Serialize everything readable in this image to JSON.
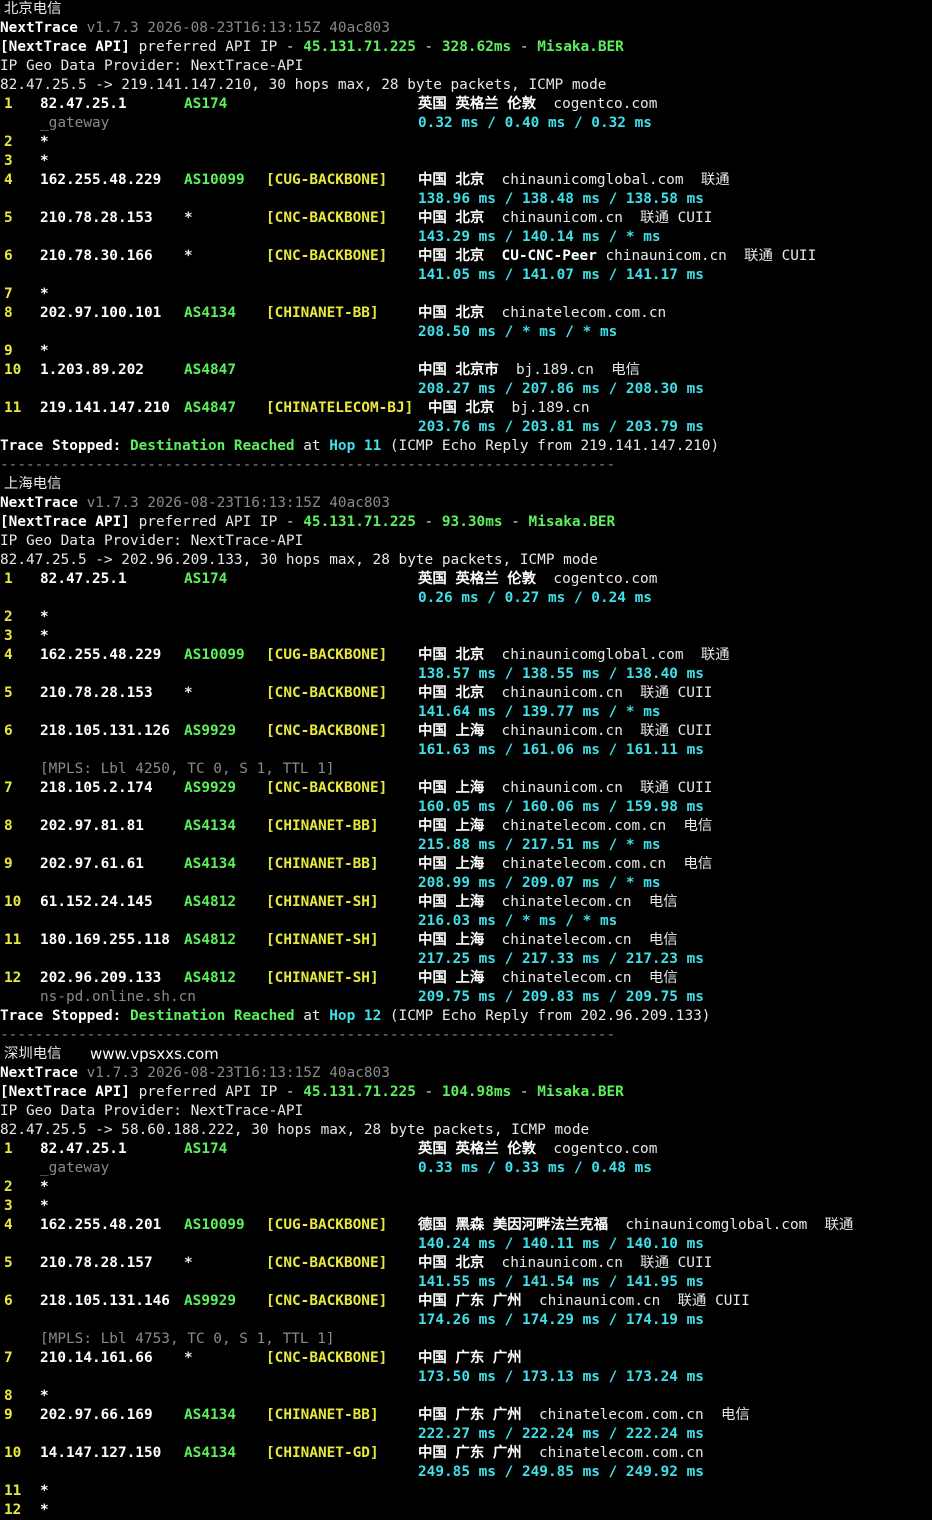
{
  "sections": [
    {
      "label": "北京电信",
      "watermark": "",
      "header": {
        "tool": "NextTrace",
        "version": "v1.7.3 2026-08-23T16:13:15Z 40ac803",
        "api_prefix": "[NextTrace API]",
        "api_mid": " preferred API IP - ",
        "api_ip": "45.131.71.225",
        "api_dash": " - ",
        "api_ms": "328.62ms",
        "api_node": "Misaka.BER",
        "geo_provider": "IP Geo Data Provider: NextTrace-API",
        "route": "82.47.25.5 -> 219.141.147.210, 30 hops max, 28 byte packets, ICMP mode"
      },
      "hops": [
        {
          "hop": "1",
          "ip": "82.47.25.1",
          "asn": "AS174",
          "tag": "",
          "geo": "英国 英格兰 伦敦",
          "extra": "cogentco.com",
          "rtt": "0.32 ms / 0.40 ms / 0.32 ms",
          "host": "_gateway",
          "mpls": ""
        },
        {
          "hop": "2",
          "ip": "*",
          "asn": "",
          "tag": "",
          "geo": "",
          "extra": "",
          "rtt": "",
          "host": "",
          "mpls": ""
        },
        {
          "hop": "3",
          "ip": "*",
          "asn": "",
          "tag": "",
          "geo": "",
          "extra": "",
          "rtt": "",
          "host": "",
          "mpls": ""
        },
        {
          "hop": "4",
          "ip": "162.255.48.229",
          "asn": "AS10099",
          "tag": "[CUG-BACKBONE]",
          "geo": "中国 北京",
          "extra": "  chinaunicomglobal.com  联通",
          "rtt": "138.96 ms / 138.48 ms / 138.58 ms",
          "host": "",
          "mpls": ""
        },
        {
          "hop": "5",
          "ip": "210.78.28.153",
          "asn": "*",
          "tag": "[CNC-BACKBONE]",
          "geo": "中国 北京",
          "extra": "  chinaunicom.cn  联通 CUII",
          "rtt": "143.29 ms / 140.14 ms / * ms",
          "host": "",
          "mpls": ""
        },
        {
          "hop": "6",
          "ip": "210.78.30.166",
          "asn": "*",
          "tag": "[CNC-BACKBONE]",
          "geo": "中国 北京  CU-CNC-Peer",
          "extra": " chinaunicom.cn  联通 CUII",
          "rtt": "141.05 ms / 141.07 ms / 141.17 ms",
          "host": "",
          "mpls": ""
        },
        {
          "hop": "7",
          "ip": "*",
          "asn": "",
          "tag": "",
          "geo": "",
          "extra": "",
          "rtt": "",
          "host": "",
          "mpls": ""
        },
        {
          "hop": "8",
          "ip": "202.97.100.101",
          "asn": "AS4134",
          "tag": "[CHINANET-BB]",
          "geo": "中国 北京",
          "extra": "  chinatelecom.com.cn",
          "rtt": "208.50 ms / * ms / * ms",
          "host": "",
          "mpls": ""
        },
        {
          "hop": "9",
          "ip": "*",
          "asn": "",
          "tag": "",
          "geo": "",
          "extra": "",
          "rtt": "",
          "host": "",
          "mpls": ""
        },
        {
          "hop": "10",
          "ip": "1.203.89.202",
          "asn": "AS4847",
          "tag": "",
          "geo": "中国 北京市",
          "extra": "  bj.189.cn  电信",
          "rtt": "208.27 ms / 207.86 ms / 208.30 ms",
          "host": "",
          "mpls": ""
        },
        {
          "hop": "11",
          "ip": "219.141.147.210",
          "asn": "AS4847",
          "tag": "[CHINATELECOM-BJ]",
          "geo": "中国 北京",
          "extra": "  bj.189.cn",
          "rtt": "203.76 ms / 203.81 ms / 203.79 ms",
          "host": "",
          "mpls": ""
        }
      ],
      "stop": {
        "label": "Trace Stopped:",
        "dest": "Destination Reached",
        "at": " at ",
        "hop": "Hop 11",
        "tail": " (ICMP Echo Reply from 219.141.147.210)"
      },
      "separator": "-----------------------------------------------------------------------"
    },
    {
      "label": "上海电信",
      "watermark": "",
      "header": {
        "tool": "NextTrace",
        "version": "v1.7.3 2026-08-23T16:13:15Z 40ac803",
        "api_prefix": "[NextTrace API]",
        "api_mid": " preferred API IP - ",
        "api_ip": "45.131.71.225",
        "api_dash": " - ",
        "api_ms": "93.30ms",
        "api_node": "Misaka.BER",
        "geo_provider": "IP Geo Data Provider: NextTrace-API",
        "route": "82.47.25.5 -> 202.96.209.133, 30 hops max, 28 byte packets, ICMP mode"
      },
      "hops": [
        {
          "hop": "1",
          "ip": "82.47.25.1",
          "asn": "AS174",
          "tag": "",
          "geo": "英国 英格兰 伦敦",
          "extra": "cogentco.com",
          "rtt": "0.26 ms / 0.27 ms / 0.24 ms",
          "host": " ",
          "mpls": ""
        },
        {
          "hop": "2",
          "ip": "*",
          "asn": "",
          "tag": "",
          "geo": "",
          "extra": "",
          "rtt": "",
          "host": "",
          "mpls": ""
        },
        {
          "hop": "3",
          "ip": "*",
          "asn": "",
          "tag": "",
          "geo": "",
          "extra": "",
          "rtt": "",
          "host": "",
          "mpls": ""
        },
        {
          "hop": "4",
          "ip": "162.255.48.229",
          "asn": "AS10099",
          "tag": "[CUG-BACKBONE]",
          "geo": "中国 北京",
          "extra": "  chinaunicomglobal.com  联通",
          "rtt": "138.57 ms / 138.55 ms / 138.40 ms",
          "host": "",
          "mpls": ""
        },
        {
          "hop": "5",
          "ip": "210.78.28.153",
          "asn": "*",
          "tag": "[CNC-BACKBONE]",
          "geo": "中国 北京",
          "extra": "  chinaunicom.cn  联通 CUII",
          "rtt": "141.64 ms / 139.77 ms / * ms",
          "host": "",
          "mpls": ""
        },
        {
          "hop": "6",
          "ip": "218.105.131.126",
          "asn": "AS9929",
          "tag": "[CNC-BACKBONE]",
          "geo": "中国 上海",
          "extra": "  chinaunicom.cn  联通 CUII",
          "rtt": "161.63 ms / 161.06 ms / 161.11 ms",
          "host": " ",
          "mpls": "[MPLS: Lbl 4250, TC 0, S 1, TTL 1]"
        },
        {
          "hop": "7",
          "ip": "218.105.2.174",
          "asn": "AS9929",
          "tag": "[CNC-BACKBONE]",
          "geo": "中国 上海",
          "extra": "  chinaunicom.cn  联通 CUII",
          "rtt": "160.05 ms / 160.06 ms / 159.98 ms",
          "host": "",
          "mpls": ""
        },
        {
          "hop": "8",
          "ip": "202.97.81.81",
          "asn": "AS4134",
          "tag": "[CHINANET-BB]",
          "geo": "中国 上海",
          "extra": "  chinatelecom.com.cn  电信",
          "rtt": "215.88 ms / 217.51 ms / * ms",
          "host": "",
          "mpls": ""
        },
        {
          "hop": "9",
          "ip": "202.97.61.61",
          "asn": "AS4134",
          "tag": "[CHINANET-BB]",
          "geo": "中国 上海",
          "extra": "  chinatelecom.com.cn  电信",
          "rtt": "208.99 ms / 209.07 ms / * ms",
          "host": "",
          "mpls": ""
        },
        {
          "hop": "10",
          "ip": "61.152.24.145",
          "asn": "AS4812",
          "tag": "[CHINANET-SH]",
          "geo": "中国 上海",
          "extra": "  chinatelecom.cn  电信",
          "rtt": "216.03 ms / * ms / * ms",
          "host": "",
          "mpls": ""
        },
        {
          "hop": "11",
          "ip": "180.169.255.118",
          "asn": "AS4812",
          "tag": "[CHINANET-SH]",
          "geo": "中国 上海",
          "extra": "  chinatelecom.cn  电信",
          "rtt": "217.25 ms / 217.33 ms / 217.23 ms",
          "host": "",
          "mpls": ""
        },
        {
          "hop": "12",
          "ip": "202.96.209.133",
          "asn": "AS4812",
          "tag": "[CHINANET-SH]",
          "geo": "中国 上海",
          "extra": "  chinatelecom.cn  电信",
          "rtt": "209.75 ms / 209.83 ms / 209.75 ms",
          "host": "ns-pd.online.sh.cn",
          "mpls": ""
        }
      ],
      "stop": {
        "label": "Trace Stopped:",
        "dest": "Destination Reached",
        "at": " at ",
        "hop": "Hop 12",
        "tail": " (ICMP Echo Reply from 202.96.209.133)"
      },
      "separator": "-----------------------------------------------------------------------"
    },
    {
      "label": "深圳电信",
      "watermark": "www.vpsxxs.com",
      "header": {
        "tool": "NextTrace",
        "version": "v1.7.3 2026-08-23T16:13:15Z 40ac803",
        "api_prefix": "[NextTrace API]",
        "api_mid": " preferred API IP - ",
        "api_ip": "45.131.71.225",
        "api_dash": " - ",
        "api_ms": "104.98ms",
        "api_node": "Misaka.BER",
        "geo_provider": "IP Geo Data Provider: NextTrace-API",
        "route": "82.47.25.5 -> 58.60.188.222, 30 hops max, 28 byte packets, ICMP mode"
      },
      "hops": [
        {
          "hop": "1",
          "ip": "82.47.25.1",
          "asn": "AS174",
          "tag": "",
          "geo": "英国 英格兰 伦敦",
          "extra": "cogentco.com",
          "rtt": "0.33 ms / 0.33 ms / 0.48 ms",
          "host": "_gateway",
          "mpls": ""
        },
        {
          "hop": "2",
          "ip": "*",
          "asn": "",
          "tag": "",
          "geo": "",
          "extra": "",
          "rtt": "",
          "host": "",
          "mpls": ""
        },
        {
          "hop": "3",
          "ip": "*",
          "asn": "",
          "tag": "",
          "geo": "",
          "extra": "",
          "rtt": "",
          "host": "",
          "mpls": ""
        },
        {
          "hop": "4",
          "ip": "162.255.48.201",
          "asn": "AS10099",
          "tag": "[CUG-BACKBONE]",
          "geo": "德国 黑森 美因河畔法兰克福",
          "extra": "  chinaunicomglobal.com  联通",
          "rtt": "140.24 ms / 140.11 ms / 140.10 ms",
          "host": "",
          "mpls": ""
        },
        {
          "hop": "5",
          "ip": "210.78.28.157",
          "asn": "*",
          "tag": "[CNC-BACKBONE]",
          "geo": "中国 北京",
          "extra": "  chinaunicom.cn  联通 CUII",
          "rtt": "141.55 ms / 141.54 ms / 141.95 ms",
          "host": "",
          "mpls": ""
        },
        {
          "hop": "6",
          "ip": "218.105.131.146",
          "asn": "AS9929",
          "tag": "[CNC-BACKBONE]",
          "geo": "中国 广东 广州",
          "extra": "  chinaunicom.cn  联通 CUII",
          "rtt": "174.26 ms / 174.29 ms / 174.19 ms",
          "host": " ",
          "mpls": "[MPLS: Lbl 4753, TC 0, S 1, TTL 1]"
        },
        {
          "hop": "7",
          "ip": "210.14.161.66",
          "asn": "*",
          "tag": "[CNC-BACKBONE]",
          "geo": "中国 广东 广州",
          "extra": "",
          "rtt": "173.50 ms / 173.13 ms / 173.24 ms",
          "host": " ",
          "mpls": ""
        },
        {
          "hop": "8",
          "ip": "*",
          "asn": "",
          "tag": "",
          "geo": "",
          "extra": "",
          "rtt": "",
          "host": "",
          "mpls": ""
        },
        {
          "hop": "9",
          "ip": "202.97.66.169",
          "asn": "AS4134",
          "tag": "[CHINANET-BB]",
          "geo": "中国 广东 广州",
          "extra": "  chinatelecom.com.cn  电信",
          "rtt": "222.27 ms / 222.24 ms / 222.24 ms",
          "host": "",
          "mpls": ""
        },
        {
          "hop": "10",
          "ip": "14.147.127.150",
          "asn": "AS4134",
          "tag": "[CHINANET-GD]",
          "geo": "中国 广东 广州",
          "extra": "  chinatelecom.com.cn",
          "rtt": "249.85 ms / 249.85 ms / 249.92 ms",
          "host": " ",
          "mpls": ""
        },
        {
          "hop": "11",
          "ip": "*",
          "asn": "",
          "tag": "",
          "geo": "",
          "extra": "",
          "rtt": "",
          "host": "",
          "mpls": ""
        },
        {
          "hop": "12",
          "ip": "*",
          "asn": "",
          "tag": "",
          "geo": "",
          "extra": "",
          "rtt": "",
          "host": "",
          "mpls": ""
        }
      ],
      "stop": null,
      "separator": ""
    }
  ]
}
